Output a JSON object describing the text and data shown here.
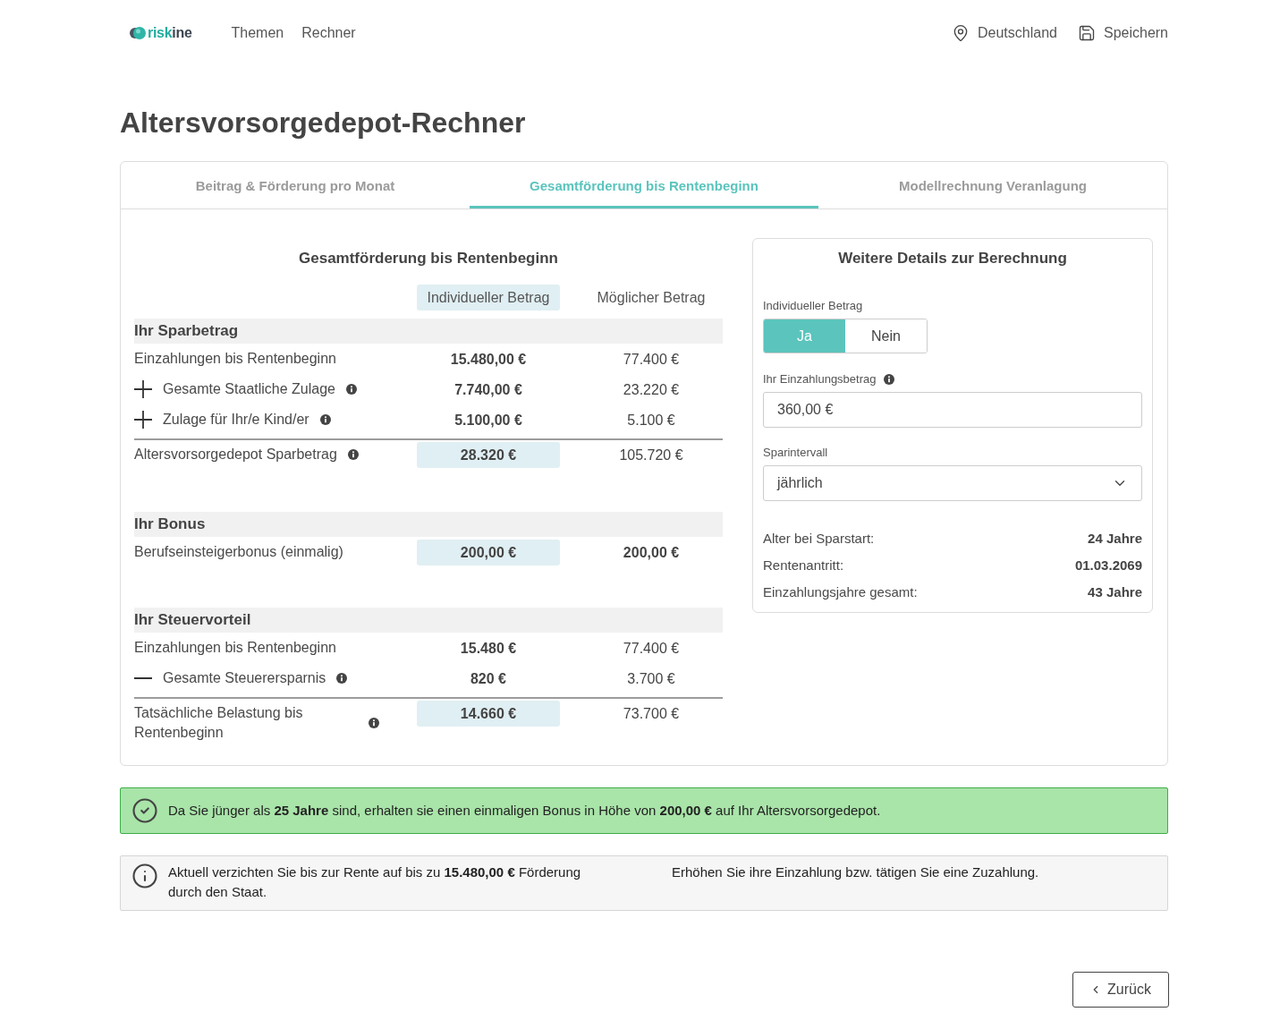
{
  "header": {
    "logo": {
      "accent": "risk",
      "rest": "ine"
    },
    "nav": [
      {
        "label": "Themen"
      },
      {
        "label": "Rechner"
      }
    ],
    "actions": [
      {
        "kind": "location",
        "label": "Deutschland"
      },
      {
        "kind": "save",
        "label": "Speichern"
      }
    ]
  },
  "page_title": "Altersvorsorgedepot-Rechner",
  "tabs": [
    {
      "label": "Beitrag & Förderung pro Monat",
      "selected": false
    },
    {
      "label": "Gesamtförderung bis Rentenbeginn",
      "selected": true
    },
    {
      "label": "Modellrechnung Veranlagung",
      "selected": false
    }
  ],
  "summary": {
    "title": "Gesamtförderung bis Rentenbeginn",
    "columns": [
      {
        "label": "Individueller Betrag",
        "highlighted": true
      },
      {
        "label": "Möglicher Betrag",
        "highlighted": false
      }
    ],
    "sections": [
      {
        "title": "Ihr Sparbetrag",
        "rows": [
          {
            "kind": "item",
            "label": "Einzahlungen bis Rentenbeginn",
            "info": false,
            "values": [
              {
                "text": "15.480,00 €",
                "bold": true,
                "highlighted": false
              },
              {
                "text": "77.400 €",
                "bold": false,
                "highlighted": false
              }
            ]
          },
          {
            "kind": "plus",
            "label": "Gesamte Staatliche Zulage",
            "info": true,
            "values": [
              {
                "text": "7.740,00 €",
                "bold": true,
                "highlighted": false
              },
              {
                "text": "23.220 €",
                "bold": false,
                "highlighted": false
              }
            ]
          },
          {
            "kind": "plus",
            "label": "Zulage für Ihr/e Kind/er",
            "info": true,
            "values": [
              {
                "text": "5.100,00 €",
                "bold": true,
                "highlighted": false
              },
              {
                "text": "5.100 €",
                "bold": false,
                "highlighted": false
              }
            ]
          },
          {
            "kind": "total",
            "label": "Altersvorsorgedepot Sparbetrag",
            "info": true,
            "values": [
              {
                "text": "28.320 €",
                "bold": true,
                "highlighted": true
              },
              {
                "text": "105.720 €",
                "bold": false,
                "highlighted": false
              }
            ]
          }
        ]
      },
      {
        "title": "Ihr Bonus",
        "rows": [
          {
            "kind": "item",
            "label": "Berufseinsteigerbonus (einmalig)",
            "info": false,
            "values": [
              {
                "text": "200,00 €",
                "bold": true,
                "highlighted": true
              },
              {
                "text": "200,00 €",
                "bold": true,
                "highlighted": false
              }
            ]
          }
        ]
      },
      {
        "title": "Ihr Steuervorteil",
        "rows": [
          {
            "kind": "item",
            "label": "Einzahlungen bis Rentenbeginn",
            "info": false,
            "values": [
              {
                "text": "15.480 €",
                "bold": true,
                "highlighted": false
              },
              {
                "text": "77.400 €",
                "bold": false,
                "highlighted": false
              }
            ]
          },
          {
            "kind": "minus",
            "label": "Gesamte Steuerersparnis",
            "info": true,
            "values": [
              {
                "text": "820 €",
                "bold": true,
                "highlighted": false
              },
              {
                "text": "3.700 €",
                "bold": false,
                "highlighted": false
              }
            ]
          },
          {
            "kind": "total",
            "label": "Tatsächliche Belastung bis Rentenbeginn",
            "info": true,
            "values": [
              {
                "text": "14.660 €",
                "bold": true,
                "highlighted": true
              },
              {
                "text": "73.700 €",
                "bold": false,
                "highlighted": false
              }
            ]
          }
        ]
      }
    ]
  },
  "details": {
    "title": "Weitere Details zur Berechnung",
    "toggle": {
      "label": "Individueller Betrag",
      "options": [
        {
          "label": "Ja",
          "selected": true
        },
        {
          "label": "Nein",
          "selected": false
        }
      ]
    },
    "amount": {
      "label": "Ihr Einzahlungsbetrag",
      "info": true,
      "value": "360,00 €"
    },
    "interval": {
      "label": "Sparintervall",
      "value": "jährlich"
    },
    "facts": [
      {
        "label": "Alter bei Sparstart:",
        "value": "24 Jahre"
      },
      {
        "label": "Rentenantritt:",
        "value": "01.03.2069"
      },
      {
        "label": "Einzahlungsjahre gesamt:",
        "value": "43 Jahre"
      }
    ]
  },
  "notices": [
    {
      "kind": "success",
      "text": "Da Sie jünger als **25 Jahre** sind, erhalten sie einen einmaligen Bonus in Höhe von **200,00 €** auf Ihr Altersvorsorgedepot."
    },
    {
      "kind": "info",
      "text": "Aktuell verzichten Sie bis zur Rente auf bis zu **15.480,00 €** Förderung durch den Staat.",
      "hint": "Erhöhen Sie ihre Einzahlung bzw. tätigen Sie eine Zuzahlung."
    }
  ],
  "back_button": {
    "label": "Zurück"
  }
}
